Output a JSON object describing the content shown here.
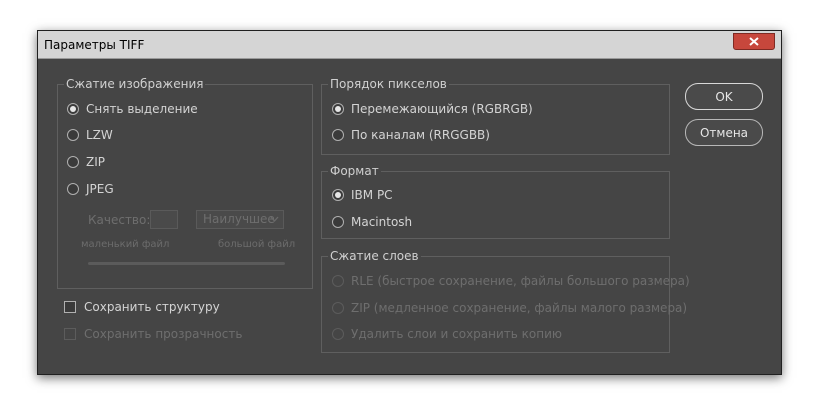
{
  "dialog": {
    "title": "Параметры TIFF",
    "close_icon": "close-icon"
  },
  "image_compression": {
    "legend": "Сжатие изображения",
    "options": [
      {
        "label": "Снять выделение",
        "checked": true,
        "enabled": true
      },
      {
        "label": "LZW",
        "checked": false,
        "enabled": true
      },
      {
        "label": "ZIP",
        "checked": false,
        "enabled": true
      },
      {
        "label": "JPEG",
        "checked": false,
        "enabled": true
      }
    ],
    "quality_label": "Качество:",
    "quality_value": "",
    "quality_select": "Наилучшее",
    "small_file_label": "маленький файл",
    "large_file_label": "большой файл"
  },
  "pixel_order": {
    "legend": "Порядок пикселов",
    "options": [
      {
        "label": "Перемежающийся (RGBRGB)",
        "checked": true,
        "enabled": true
      },
      {
        "label": "По каналам (RRGGBB)",
        "checked": false,
        "enabled": true
      }
    ]
  },
  "byte_order": {
    "legend": "Формат",
    "options": [
      {
        "label": "IBM PC",
        "checked": true,
        "enabled": true
      },
      {
        "label": "Macintosh",
        "checked": false,
        "enabled": true
      }
    ]
  },
  "layer_compression": {
    "legend": "Сжатие слоев",
    "options": [
      {
        "label": "RLE (быстрое сохранение, файлы большого размера)",
        "checked": false,
        "enabled": false
      },
      {
        "label": "ZIP (медленное сохранение, файлы малого размера)",
        "checked": false,
        "enabled": false
      },
      {
        "label": "Удалить слои и сохранить копию",
        "checked": false,
        "enabled": false
      }
    ]
  },
  "checkboxes": {
    "save_structure": "Сохранить структуру",
    "save_transparency": "Сохранить прозрачность"
  },
  "buttons": {
    "ok": "OK",
    "cancel": "Отмена"
  },
  "colors": {
    "dialog_bg": "#454545",
    "titlebar_bg": "#d5d5d5",
    "close_button": "#c7473c"
  }
}
